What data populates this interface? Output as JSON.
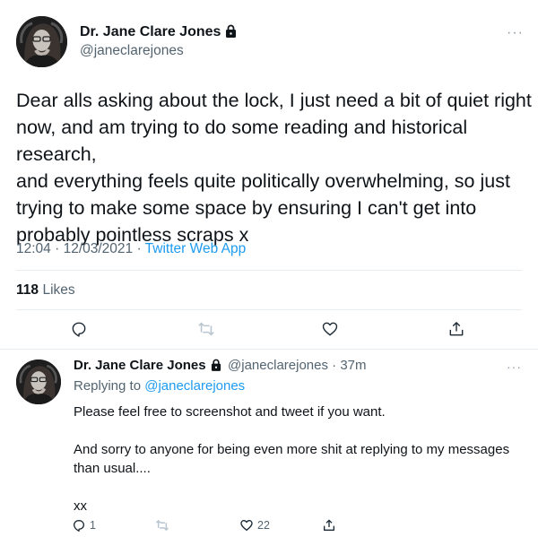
{
  "main_tweet": {
    "author_name": "Dr. Jane Clare Jones",
    "author_handle": "@janeclarejones",
    "text_lines": [
      "Dear alls asking about the lock, I just need a bit of quiet right",
      "now, and am trying to do some reading and historical research,",
      "and everything feels quite politically overwhelming, so just",
      "trying to make some space by ensuring I can't get into",
      "probably pointless scraps x"
    ],
    "time": "12:04",
    "date": "12/03/2021",
    "source": "Twitter Web App",
    "likes_count": "118",
    "likes_label": "Likes",
    "more_label": "···"
  },
  "reply_tweet": {
    "author_name": "Dr. Jane Clare Jones",
    "author_handle": "@janeclarejones",
    "age": "37m",
    "replying_prefix": "Replying to",
    "replying_handle": "@janeclarejones",
    "text_lines": [
      "Please feel free to screenshot and tweet if you want.",
      "",
      "And sorry to anyone for being even more shit at replying to my messages",
      "than usual....",
      "",
      "xx"
    ],
    "reply_count": "1",
    "like_count": "22",
    "more_label": "···"
  },
  "colors": {
    "text": "#0f1419",
    "secondary": "#536471",
    "link": "#1d9bf0",
    "divider": "#e6ecf0",
    "retweet_disabled": "#b8c5cf"
  },
  "icons": [
    "lock-icon",
    "reply-icon",
    "retweet-icon",
    "like-icon",
    "share-icon",
    "more-icon"
  ]
}
